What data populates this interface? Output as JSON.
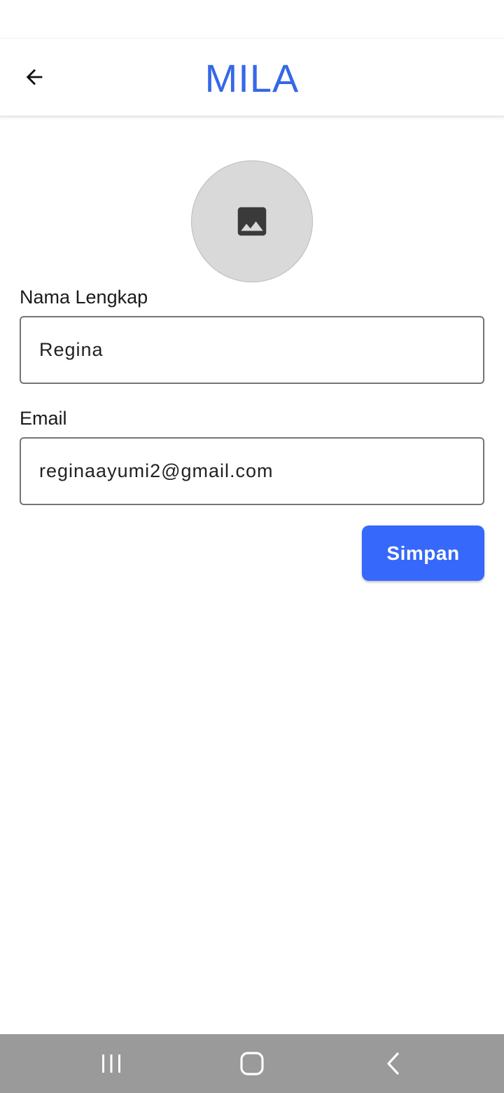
{
  "app_bar": {
    "title": "MILA",
    "back_icon": "arrow-left-icon"
  },
  "avatar": {
    "icon": "image-icon"
  },
  "form": {
    "full_name_label": "Nama Lengkap",
    "full_name_value": "Regina",
    "email_label": "Email",
    "email_value": "reginaayumi2@gmail.com",
    "save_label": "Simpan"
  },
  "nav_bar": {
    "recents_icon": "recents-icon",
    "home_icon": "home-icon",
    "back_icon": "chevron-left-icon"
  },
  "colors": {
    "accent": "#3568e8",
    "button": "#3568fb",
    "nav_bar": "#9a9a9a",
    "avatar_bg": "#d9d9d9"
  }
}
